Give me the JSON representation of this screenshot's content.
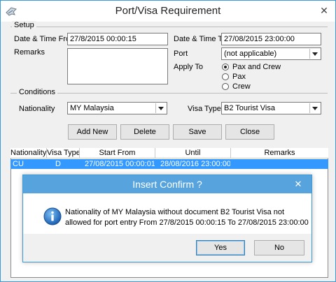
{
  "window": {
    "title": "Port/Visa Requirement",
    "close_glyph": "✕"
  },
  "setup": {
    "group_label": "Setup",
    "date_from_label": "Date & Time From",
    "date_from_value": "27/8/2015 00:00:15",
    "date_to_label": "Date & Time To",
    "date_to_value": "27/08/2015 23:00:00",
    "remarks_label": "Remarks",
    "remarks_value": "",
    "port_label": "Port",
    "port_value": "(not applicable)",
    "apply_to_label": "Apply To",
    "apply_options": [
      "Pax and Crew",
      "Pax",
      "Crew"
    ],
    "apply_selected": "Pax and Crew"
  },
  "conditions": {
    "group_label": "Conditions",
    "nationality_label": "Nationality",
    "nationality_value": "MY Malaysia",
    "visa_type_label": "Visa Type",
    "visa_type_value": "B2 Tourist Visa"
  },
  "buttons": {
    "add_new": "Add New",
    "delete": "Delete",
    "save": "Save",
    "close": "Close"
  },
  "grid": {
    "columns": [
      "Nationality",
      "Visa Type",
      "Start From",
      "Until",
      "Remarks"
    ],
    "rows": [
      {
        "nationality": "CU",
        "visa_type": "D",
        "start_from": "27/08/2015 00:00:01",
        "until": "28/08/2016 23:00:00",
        "remarks": ""
      }
    ]
  },
  "dialog": {
    "title": "Insert Confirm ?",
    "close_glyph": "✕",
    "message_line1": "Nationality of MY Malaysia without document B2 Tourist Visa not",
    "message_line2": "allowed for port entry From 27/8/2015 00:00:15 To 27/08/2015 23:00:00",
    "yes_label": "Yes",
    "no_label": "No",
    "icon": "info-icon"
  },
  "colors": {
    "accent": "#3c9ad6",
    "dialog_title": "#56a3dd",
    "selection": "#3399ff"
  }
}
